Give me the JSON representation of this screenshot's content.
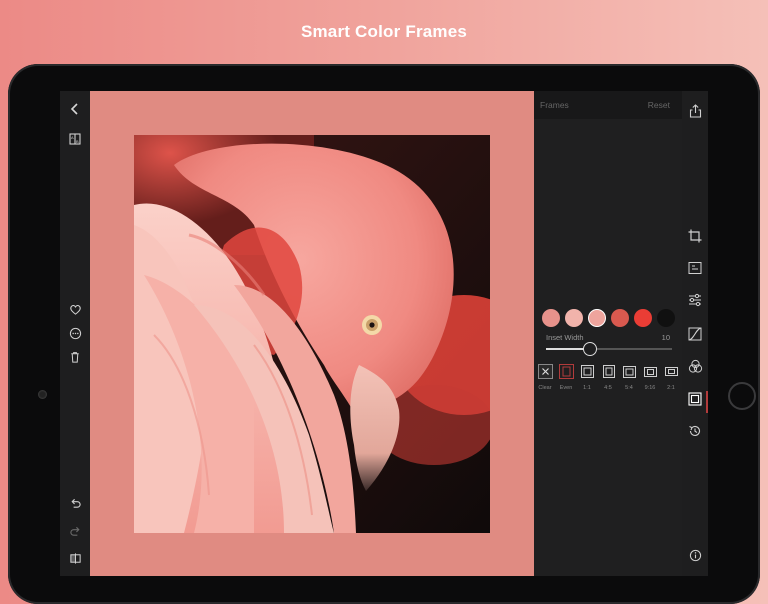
{
  "headline": "Smart Color Frames",
  "left_toolbar": {
    "icons": [
      "back-icon",
      "compare-icon",
      "heart-icon",
      "more-icon",
      "trash-icon",
      "undo-icon",
      "redo-icon",
      "split-view-icon"
    ]
  },
  "panel": {
    "title": "Frames",
    "reset_label": "Reset",
    "swatches": [
      "#e7928b",
      "#f1b3ab",
      "#eea49d",
      "#d9594f",
      "#ea3d35",
      "#101010"
    ],
    "selected_swatch": 2,
    "inset_label": "Inset Width",
    "inset_value": "10",
    "inset_fraction": 0.35,
    "frame_options": [
      {
        "label": "Clear",
        "icon": "clear-icon"
      },
      {
        "label": "Even",
        "icon": "even-frame-icon"
      },
      {
        "label": "1:1",
        "icon": "ratio-1-1-icon"
      },
      {
        "label": "4:5",
        "icon": "ratio-4-5-icon"
      },
      {
        "label": "5:4",
        "icon": "ratio-5-4-icon"
      },
      {
        "label": "9:16",
        "icon": "ratio-9-16-icon"
      },
      {
        "label": "2:1",
        "icon": "ratio-2-1-icon"
      }
    ],
    "selected_frame": 1
  },
  "right_toolbar": {
    "icons": [
      "share-icon",
      "crop-icon",
      "text-icon",
      "adjust-icon",
      "curves-icon",
      "color-mix-icon",
      "frame-icon",
      "history-icon",
      "info-icon"
    ]
  },
  "colors": {
    "frame_color": "#e08b82",
    "accent": "#b23b3b"
  }
}
